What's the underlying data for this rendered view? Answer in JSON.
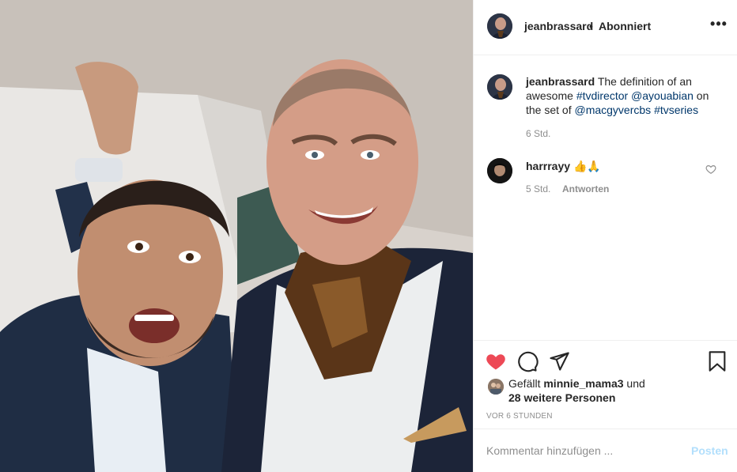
{
  "post": {
    "username": "jeanbrassard",
    "separator": "•",
    "follow_status": "Abonniert",
    "more_icon": "more-horizontal-icon"
  },
  "caption": {
    "username": "jeanbrassard",
    "text_1": "The definition of an awesome",
    "tag_1": "#tvdirector",
    "mention_1": "@ayouabian",
    "text_2": "on the set of",
    "mention_2": "@macgyvercbs",
    "tag_2": "#tvseries",
    "time": "6 Std."
  },
  "comment": {
    "username": "harrrayy",
    "text": "👍🙏",
    "time": "5 Std.",
    "reply_label": "Antworten"
  },
  "actions": {
    "liked": true,
    "like_color": "#ed4956",
    "icons": [
      "heart-icon",
      "comment-icon",
      "share-icon",
      "bookmark-icon"
    ]
  },
  "likes": {
    "prefix": "Gefällt",
    "user": "minnie_mama3",
    "and": "und",
    "others": "28 weitere Personen"
  },
  "timestamp": "VOR 6 STUNDEN",
  "comment_input": {
    "placeholder": "Kommentar hinzufügen ...",
    "post_label": "Posten"
  }
}
